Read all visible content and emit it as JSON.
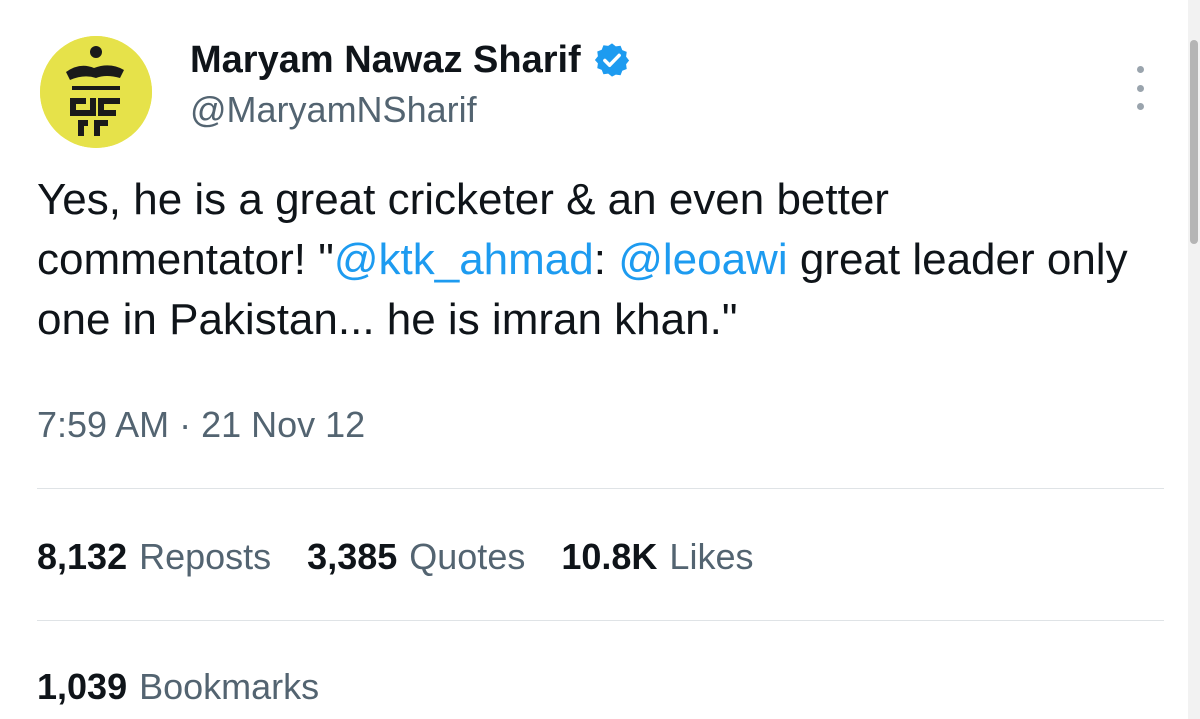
{
  "author": {
    "display_name": "Maryam Nawaz Sharif",
    "handle": "@MaryamNSharif",
    "verified_color": "#1d9bf0",
    "avatar_bg": "#e6e24a"
  },
  "tweet": {
    "text_part1": "Yes, he is a great cricketer & an even better commentator! \"",
    "mention1": "@ktk_ahmad",
    "text_part2": ": ",
    "mention2": "@leoawi",
    "text_part3": " great leader only one in Pakistan... he is imran khan.\"",
    "timestamp": "7:59 AM · 21 Nov 12"
  },
  "stats": {
    "reposts_count": "8,132",
    "reposts_label": "Reposts",
    "quotes_count": "3,385",
    "quotes_label": "Quotes",
    "likes_count": "10.8K",
    "likes_label": "Likes",
    "bookmarks_count": "1,039",
    "bookmarks_label": "Bookmarks"
  },
  "icons": {
    "more": "more-vertical-icon",
    "verified": "verified-badge-icon"
  }
}
